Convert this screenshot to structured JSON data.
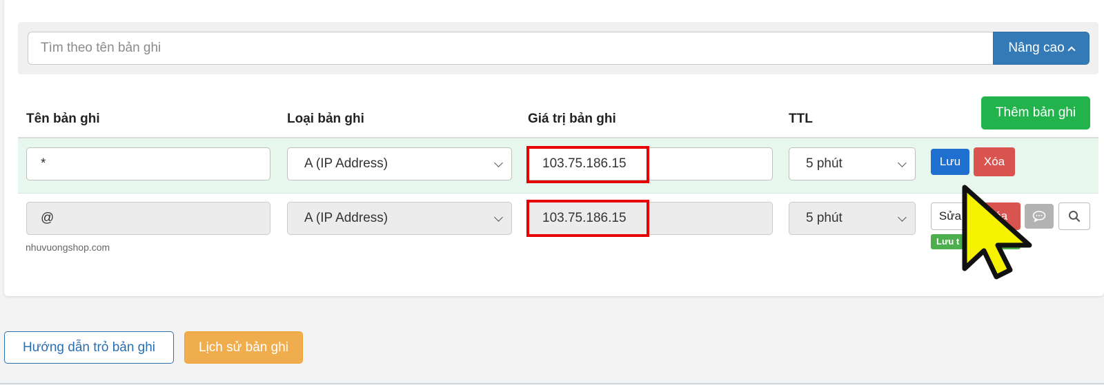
{
  "search": {
    "placeholder": "Tìm theo tên bản ghi",
    "advanced_label": "Nâng cao"
  },
  "table": {
    "headers": [
      "Tên bản ghi",
      "Loại bản ghi",
      "Giá trị bản ghi",
      "TTL"
    ],
    "add_button": "Thêm bản ghi",
    "rows": [
      {
        "name": "*",
        "type": "A (IP Address)",
        "value": "103.75.186.15",
        "ttl": "5 phút",
        "actions": {
          "save": "Lưu",
          "delete": "Xóa"
        }
      },
      {
        "name": "@",
        "domain": "nhuvuongshop.com",
        "type": "A (IP Address)",
        "value": "103.75.186.15",
        "ttl": "5 phút",
        "actions": {
          "edit": "Sửa",
          "delete": "Xóa",
          "badge": "Lưu t"
        }
      }
    ]
  },
  "footer": {
    "guide_button": "Hướng dẫn trỏ bản ghi",
    "history_button": "Lịch sử bản ghi"
  },
  "colors": {
    "primary": "#337ab7",
    "success": "#22b34c",
    "danger": "#d9534f",
    "warning": "#f0ad4e",
    "highlight": "#e60000",
    "row_highlight": "#e8f7ee"
  },
  "icons": [
    "chevron-up-icon",
    "chevron-down-icon",
    "comment-icon",
    "search-icon",
    "mouse-cursor-icon"
  ]
}
